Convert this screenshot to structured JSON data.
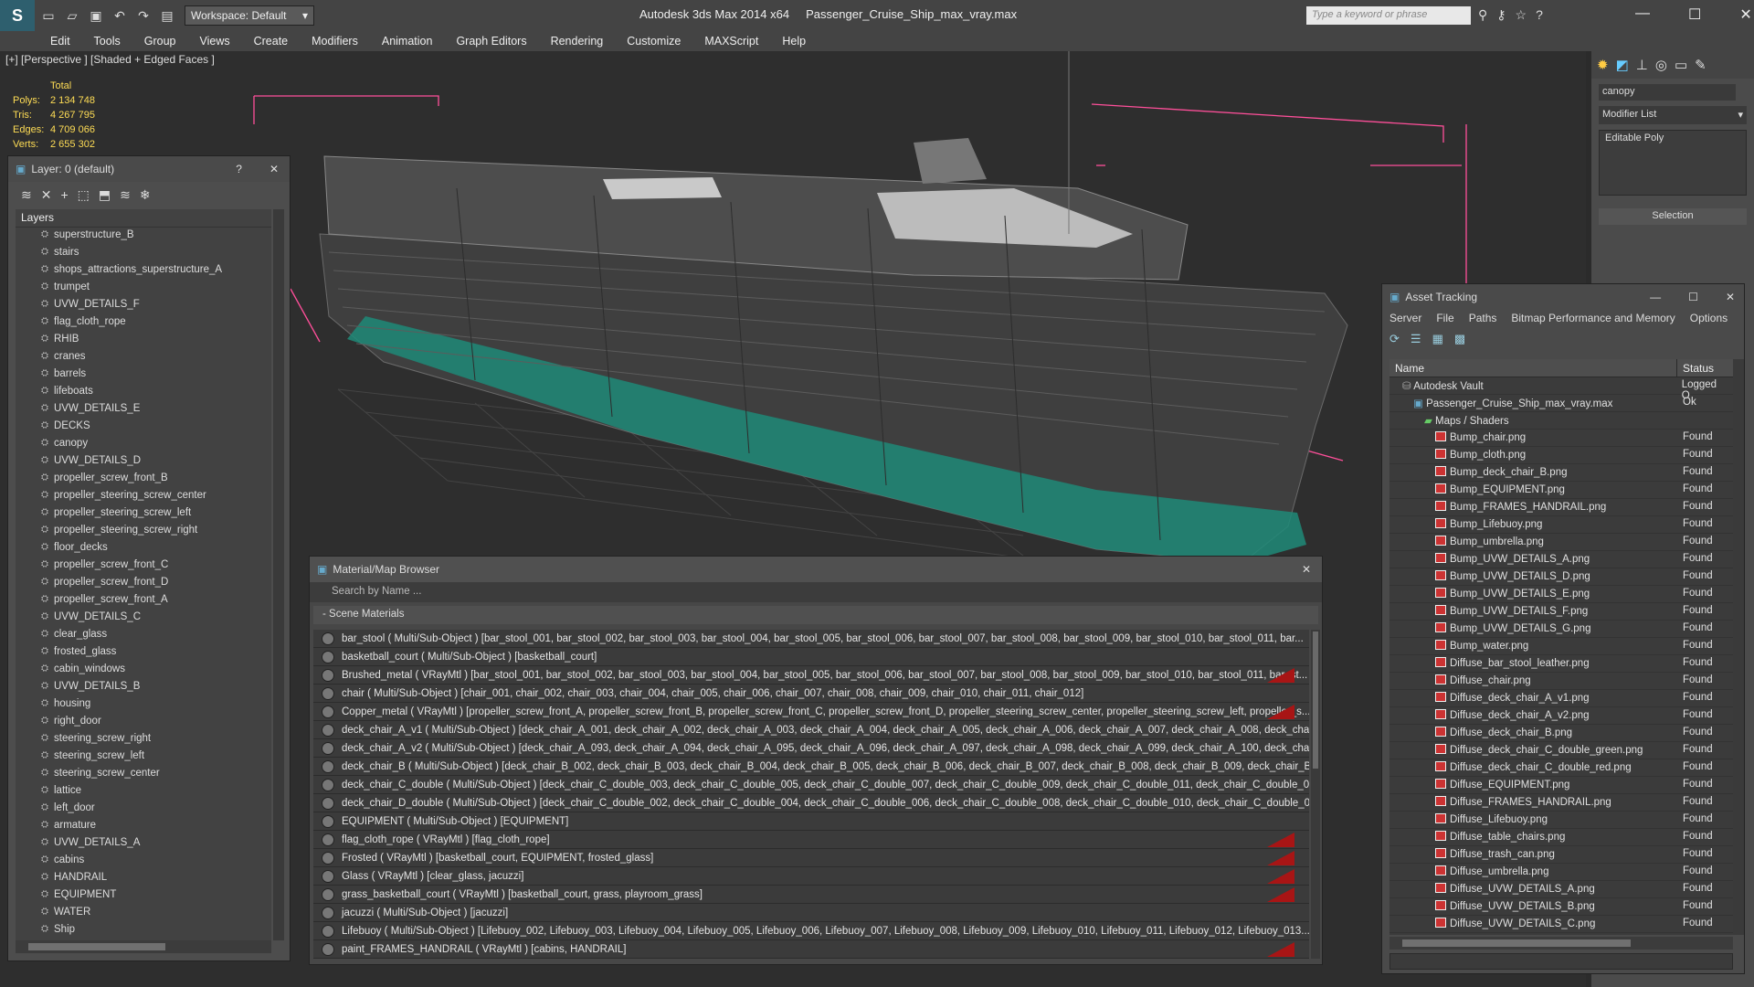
{
  "app": {
    "title": "Autodesk 3ds Max  2014 x64",
    "file": "Passenger_Cruise_Ship_max_vray.max",
    "workspace": "Workspace: Default",
    "search_placeholder": "Type a keyword or phrase"
  },
  "menu": [
    "Edit",
    "Tools",
    "Group",
    "Views",
    "Create",
    "Modifiers",
    "Animation",
    "Graph Editors",
    "Rendering",
    "Customize",
    "MAXScript",
    "Help"
  ],
  "viewport": {
    "label": "[+] [Perspective ] [Shaded + Edged Faces ]",
    "stats": {
      "total_label": "Total",
      "rows": [
        {
          "label": "Polys:",
          "value": "2 134 748"
        },
        {
          "label": "Tris:",
          "value": "4 267 795"
        },
        {
          "label": "Edges:",
          "value": "4 709 066"
        },
        {
          "label": "Verts:",
          "value": "2 655 302"
        }
      ]
    }
  },
  "layers_panel": {
    "title": "Layer: 0 (default)",
    "help": "?",
    "list_header": "Layers",
    "items": [
      "superstructure_B",
      "stairs",
      "shops_attractions_superstructure_A",
      "trumpet",
      "UVW_DETAILS_F",
      "flag_cloth_rope",
      "RHIB",
      "cranes",
      "barrels",
      "lifeboats",
      "UVW_DETAILS_E",
      "DECKS",
      "canopy",
      "UVW_DETAILS_D",
      "propeller_screw_front_B",
      "propeller_steering_screw_center",
      "propeller_steering_screw_left",
      "propeller_steering_screw_right",
      "floor_decks",
      "propeller_screw_front_C",
      "propeller_screw_front_D",
      "propeller_screw_front_A",
      "UVW_DETAILS_C",
      "clear_glass",
      "frosted_glass",
      "cabin_windows",
      "UVW_DETAILS_B",
      "housing",
      "right_door",
      "steering_screw_right",
      "steering_screw_left",
      "steering_screw_center",
      "lattice",
      "left_door",
      "armature",
      "UVW_DETAILS_A",
      "cabins",
      "HANDRAIL",
      "EQUIPMENT",
      "WATER",
      "Ship"
    ]
  },
  "material_browser": {
    "title": "Material/Map Browser",
    "search_placeholder": "Search by Name ...",
    "section": "- Scene Materials",
    "rows": [
      {
        "text": "bar_stool  ( Multi/Sub-Object ) [bar_stool_001, bar_stool_002, bar_stool_003, bar_stool_004, bar_stool_005, bar_stool_006, bar_stool_007, bar_stool_008, bar_stool_009, bar_stool_010, bar_stool_011, bar...",
        "red": false
      },
      {
        "text": "basketball_court  ( Multi/Sub-Object ) [basketball_court]",
        "red": false
      },
      {
        "text": "Brushed_metal  ( VRayMtl ) [bar_stool_001, bar_stool_002, bar_stool_003, bar_stool_004, bar_stool_005, bar_stool_006, bar_stool_007, bar_stool_008, bar_stool_009, bar_stool_010, bar_stool_011, bar_st...",
        "red": true
      },
      {
        "text": "chair  ( Multi/Sub-Object )  [chair_001, chair_002, chair_003, chair_004, chair_005, chair_006, chair_007, chair_008, chair_009, chair_010, chair_011, chair_012]",
        "red": false
      },
      {
        "text": "Copper_metal  ( VRayMtl ) [propeller_screw_front_A, propeller_screw_front_B, propeller_screw_front_C, propeller_screw_front_D, propeller_steering_screw_center, propeller_steering_screw_left, propeller_s...",
        "red": true
      },
      {
        "text": "deck_chair_A_v1  ( Multi/Sub-Object )  [deck_chair_A_001, deck_chair_A_002, deck_chair_A_003, deck_chair_A_004, deck_chair_A_005, deck_chair_A_006, deck_chair_A_007, deck_chair_A_008, deck_chai...",
        "red": false
      },
      {
        "text": "deck_chair_A_v2  ( Multi/Sub-Object )  [deck_chair_A_093, deck_chair_A_094, deck_chair_A_095, deck_chair_A_096, deck_chair_A_097, deck_chair_A_098, deck_chair_A_099, deck_chair_A_100, deck_chai...",
        "red": false
      },
      {
        "text": "deck_chair_B  ( Multi/Sub-Object )  [deck_chair_B_002, deck_chair_B_003, deck_chair_B_004, deck_chair_B_005, deck_chair_B_006, deck_chair_B_007, deck_chair_B_008, deck_chair_B_009, deck_chair_B...",
        "red": false
      },
      {
        "text": "deck_chair_C_double  ( Multi/Sub-Object ) [deck_chair_C_double_003, deck_chair_C_double_005, deck_chair_C_double_007, deck_chair_C_double_009, deck_chair_C_double_011, deck_chair_C_double_01...",
        "red": false
      },
      {
        "text": "deck_chair_D_double  ( Multi/Sub-Object ) [deck_chair_C_double_002, deck_chair_C_double_004, deck_chair_C_double_006, deck_chair_C_double_008, deck_chair_C_double_010, deck_chair_C_double_01...",
        "red": false
      },
      {
        "text": "EQUIPMENT  ( Multi/Sub-Object ) [EQUIPMENT]",
        "red": false
      },
      {
        "text": "flag_cloth_rope  ( VRayMtl ) [flag_cloth_rope]",
        "red": true
      },
      {
        "text": "Frosted  ( VRayMtl ) [basketball_court, EQUIPMENT, frosted_glass]",
        "red": true
      },
      {
        "text": "Glass  ( VRayMtl ) [clear_glass, jacuzzi]",
        "red": true
      },
      {
        "text": "grass_basketball_court  ( VRayMtl ) [basketball_court, grass, playroom_grass]",
        "red": true
      },
      {
        "text": "jacuzzi  ( Multi/Sub-Object )  [jacuzzi]",
        "red": false
      },
      {
        "text": "Lifebuoy  ( Multi/Sub-Object ) [Lifebuoy_002, Lifebuoy_003, Lifebuoy_004, Lifebuoy_005, Lifebuoy_006, Lifebuoy_007, Lifebuoy_008, Lifebuoy_009, Lifebuoy_010, Lifebuoy_011, Lifebuoy_012, Lifebuoy_013...",
        "red": false
      },
      {
        "text": "paint_FRAMES_HANDRAIL  ( VRayMtl ) [cabins, HANDRAIL]",
        "red": true
      }
    ]
  },
  "command_panel": {
    "object_name": "canopy",
    "modifier_list": "Modifier List",
    "stack_item": "Editable Poly",
    "rollout": "Selection"
  },
  "asset_tracking": {
    "title": "Asset Tracking",
    "menu": [
      "Server",
      "File",
      "Paths",
      "Bitmap Performance and Memory",
      "Options"
    ],
    "col_name": "Name",
    "col_status": "Status",
    "rows": [
      {
        "name": "Autodesk Vault",
        "status": "Logged O",
        "level": 0,
        "kind": "vault"
      },
      {
        "name": "Passenger_Cruise_Ship_max_vray.max",
        "status": "Ok",
        "level": 1,
        "kind": "max"
      },
      {
        "name": "Maps / Shaders",
        "status": "",
        "level": 2,
        "kind": "folder"
      },
      {
        "name": "Bump_chair.png",
        "status": "Found",
        "level": 3,
        "kind": "file"
      },
      {
        "name": "Bump_cloth.png",
        "status": "Found",
        "level": 3,
        "kind": "file"
      },
      {
        "name": "Bump_deck_chair_B.png",
        "status": "Found",
        "level": 3,
        "kind": "file"
      },
      {
        "name": "Bump_EQUIPMENT.png",
        "status": "Found",
        "level": 3,
        "kind": "file"
      },
      {
        "name": "Bump_FRAMES_HANDRAIL.png",
        "status": "Found",
        "level": 3,
        "kind": "file"
      },
      {
        "name": "Bump_Lifebuoy.png",
        "status": "Found",
        "level": 3,
        "kind": "file"
      },
      {
        "name": "Bump_umbrella.png",
        "status": "Found",
        "level": 3,
        "kind": "file"
      },
      {
        "name": "Bump_UVW_DETAILS_A.png",
        "status": "Found",
        "level": 3,
        "kind": "file"
      },
      {
        "name": "Bump_UVW_DETAILS_D.png",
        "status": "Found",
        "level": 3,
        "kind": "file"
      },
      {
        "name": "Bump_UVW_DETAILS_E.png",
        "status": "Found",
        "level": 3,
        "kind": "file"
      },
      {
        "name": "Bump_UVW_DETAILS_F.png",
        "status": "Found",
        "level": 3,
        "kind": "file"
      },
      {
        "name": "Bump_UVW_DETAILS_G.png",
        "status": "Found",
        "level": 3,
        "kind": "file"
      },
      {
        "name": "Bump_water.png",
        "status": "Found",
        "level": 3,
        "kind": "file"
      },
      {
        "name": "Diffuse_bar_stool_leather.png",
        "status": "Found",
        "level": 3,
        "kind": "file"
      },
      {
        "name": "Diffuse_chair.png",
        "status": "Found",
        "level": 3,
        "kind": "file"
      },
      {
        "name": "Diffuse_deck_chair_A_v1.png",
        "status": "Found",
        "level": 3,
        "kind": "file"
      },
      {
        "name": "Diffuse_deck_chair_A_v2.png",
        "status": "Found",
        "level": 3,
        "kind": "file"
      },
      {
        "name": "Diffuse_deck_chair_B.png",
        "status": "Found",
        "level": 3,
        "kind": "file"
      },
      {
        "name": "Diffuse_deck_chair_C_double_green.png",
        "status": "Found",
        "level": 3,
        "kind": "file"
      },
      {
        "name": "Diffuse_deck_chair_C_double_red.png",
        "status": "Found",
        "level": 3,
        "kind": "file"
      },
      {
        "name": "Diffuse_EQUIPMENT.png",
        "status": "Found",
        "level": 3,
        "kind": "file"
      },
      {
        "name": "Diffuse_FRAMES_HANDRAIL.png",
        "status": "Found",
        "level": 3,
        "kind": "file"
      },
      {
        "name": "Diffuse_Lifebuoy.png",
        "status": "Found",
        "level": 3,
        "kind": "file"
      },
      {
        "name": "Diffuse_table_chairs.png",
        "status": "Found",
        "level": 3,
        "kind": "file"
      },
      {
        "name": "Diffuse_trash_can.png",
        "status": "Found",
        "level": 3,
        "kind": "file"
      },
      {
        "name": "Diffuse_umbrella.png",
        "status": "Found",
        "level": 3,
        "kind": "file"
      },
      {
        "name": "Diffuse_UVW_DETAILS_A.png",
        "status": "Found",
        "level": 3,
        "kind": "file"
      },
      {
        "name": "Diffuse_UVW_DETAILS_B.png",
        "status": "Found",
        "level": 3,
        "kind": "file"
      },
      {
        "name": "Diffuse_UVW_DETAILS_C.png",
        "status": "Found",
        "level": 3,
        "kind": "file"
      }
    ]
  },
  "colors": {
    "stats_text": "#ffdd55",
    "hull_teal": "#1f8a78",
    "bbox_pink": "#ff4f9a",
    "error_red": "#a81515"
  }
}
